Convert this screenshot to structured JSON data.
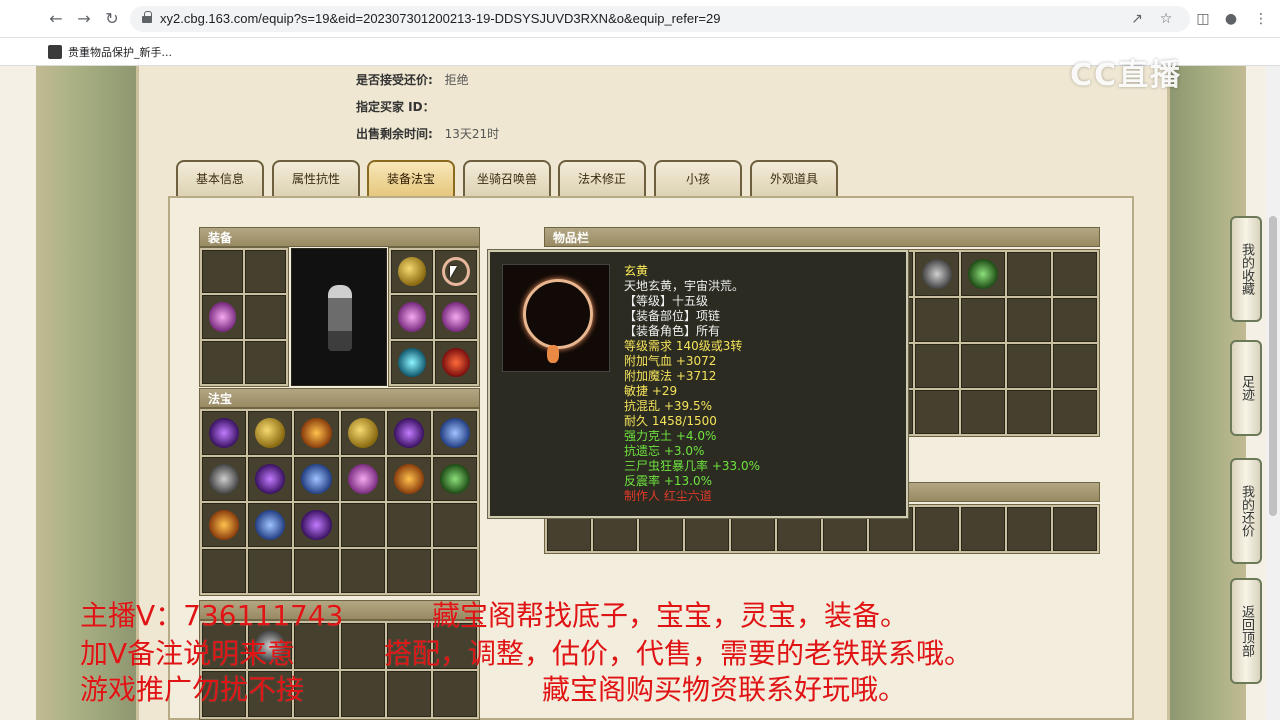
{
  "browser": {
    "url": "xy2.cbg.163.com/equip?s=19&eid=202307301200213-19-DDSYSJUVD3RXN&o&equip_refer=29",
    "bookmark": "贵重物品保护_新手..."
  },
  "info": {
    "accept_offer_label": "是否接受还价:",
    "accept_offer_value": "拒绝",
    "buyer_id_label": "指定买家 ID：",
    "buyer_id_value": "",
    "remaining_label": "出售剩余时间:",
    "remaining_value": "13天21时"
  },
  "tabs": [
    {
      "label": "基本信息"
    },
    {
      "label": "属性抗性"
    },
    {
      "label": "装备法宝"
    },
    {
      "label": "坐骑召唤兽"
    },
    {
      "label": "法术修正"
    },
    {
      "label": "小孩"
    },
    {
      "label": "外观道具"
    }
  ],
  "panels": {
    "equip_title": "装备",
    "fabao_title": "法宝",
    "inventory_title": "物品栏"
  },
  "tooltip": {
    "name": "玄黄",
    "desc": "天地玄黄，宇宙洪荒。",
    "level": "【等级】十五级",
    "slot": "【装备部位】项链",
    "role": "【装备角色】所有",
    "req": "等级需求 140级或3转",
    "hp": "附加气血 +3072",
    "mp": "附加魔法 +3712",
    "agi": "敏捷 +29",
    "resist_chaos": "抗混乱 +39.5%",
    "durability": "耐久 1458/1500",
    "strong_earth": "强力克土 +4.0%",
    "resist_forget": "抗遗忘 +3.0%",
    "crazy": "三尸虫狂暴几率 +33.0%",
    "counter": "反震率 +13.0%",
    "maker": "制作人 红尘六道"
  },
  "colors": {
    "tt_name": "#ffef5a",
    "tt_white": "#f0f0f0",
    "tt_yellow": "#f4e35a",
    "tt_green": "#6fe33f",
    "tt_red": "#e03a2a",
    "overlay_red": "#e01414"
  },
  "side_buttons": [
    {
      "label": "我的收藏"
    },
    {
      "label": "足迹"
    },
    {
      "label": "我的还价"
    },
    {
      "label": "返回顶部"
    }
  ],
  "watermark": "CC直播",
  "overlay": {
    "line1a": "主播V：736111743",
    "line1b": "藏宝阁帮找底子，宝宝，灵宝，装备。",
    "line2a": "加V备注说明来意",
    "line2b": "搭配，调整，估价，代售，需要的老铁联系哦。",
    "line3a": "游戏推广勿扰不接",
    "line3b": "藏宝阁购买物资联系好玩哦。"
  }
}
